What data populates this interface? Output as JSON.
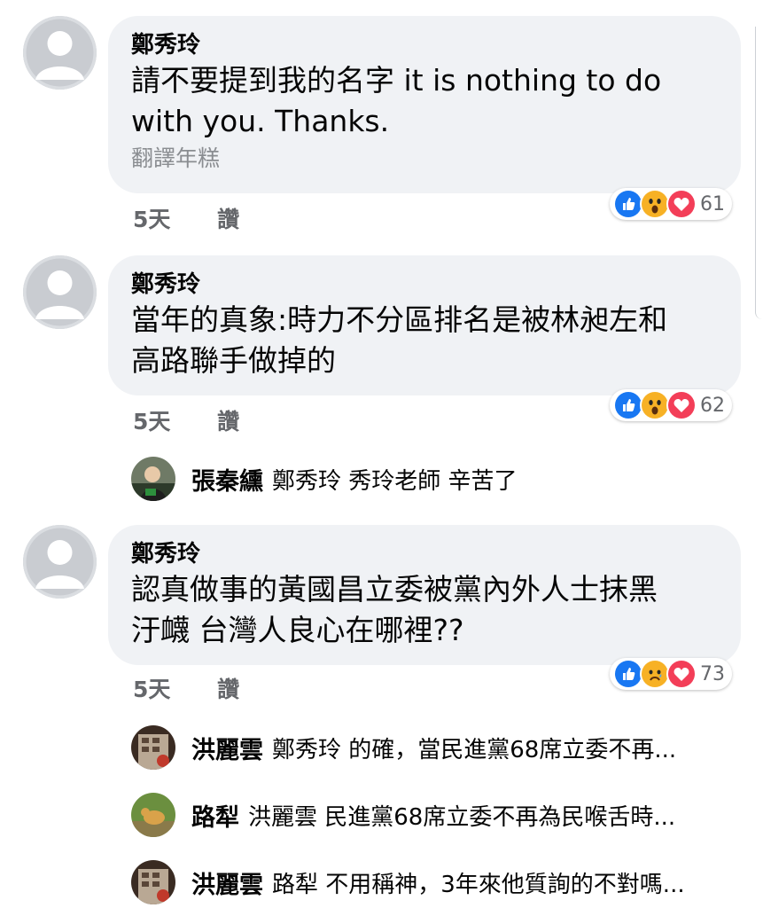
{
  "comments": [
    {
      "author": "鄭秀玲",
      "text_lines": [
        "請不要提到我的名字 it is nothing to do",
        "with you. Thanks."
      ],
      "translate": "翻譯年糕",
      "time": "5天",
      "like": "讚",
      "reactions": [
        "like-icon",
        "wow-icon",
        "love-icon"
      ],
      "reaction_count": "61"
    },
    {
      "author": "鄭秀玲",
      "text_lines": [
        "當年的真象:時力不分區排名是被林昶左和",
        "高路聯手做掉的"
      ],
      "time": "5天",
      "like": "讚",
      "reactions": [
        "like-icon",
        "wow-icon",
        "love-icon"
      ],
      "reaction_count": "62"
    },
    {
      "author": "鄭秀玲",
      "text_lines": [
        "認真做事的黃國昌立委被黨內外人士抹黑",
        "汙衊 台灣人良心在哪裡??"
      ],
      "time": "5天",
      "like": "讚",
      "reactions": [
        "like-icon",
        "sad-icon",
        "love-icon"
      ],
      "reaction_count": "73"
    }
  ],
  "replies": [
    {
      "name": "張秦纁",
      "text": "鄭秀玲 秀玲老師 辛苦了"
    },
    {
      "name": "洪麗雲",
      "text": "鄭秀玲 的確，當民進黨68席立委不再..."
    },
    {
      "name": "路犁",
      "text": "洪麗雲 民進黨68席立委不再為民喉舌時..."
    },
    {
      "name": "洪麗雲",
      "text": "路犁 不用稱神，3年來他質詢的不對嗎..."
    }
  ],
  "colors": {
    "bubble": "#f0f2f5",
    "like_blue": "#1877f2",
    "love_red": "#f33e58",
    "emoji_yellow": "#f7b125"
  }
}
